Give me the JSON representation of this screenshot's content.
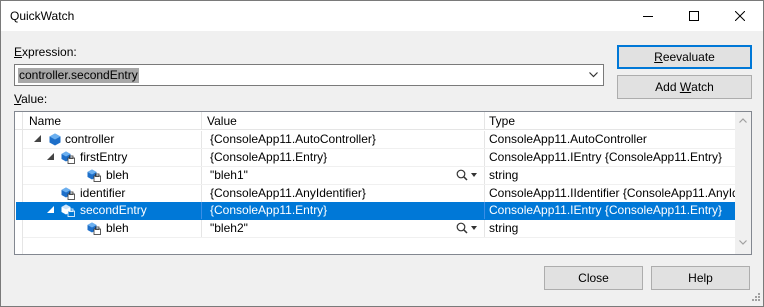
{
  "window": {
    "title": "QuickWatch"
  },
  "expression": {
    "label_prefix": "E",
    "label_rest": "xpression:",
    "value": "controller.secondEntry"
  },
  "value_section": {
    "label_prefix": "V",
    "label_rest": "alue:"
  },
  "buttons": {
    "reevaluate_prefix": "R",
    "reevaluate_rest": "eevaluate",
    "addwatch_prefix": "Add ",
    "addwatch_underline": "W",
    "addwatch_rest": "atch",
    "close": "Close",
    "help": "Help"
  },
  "grid": {
    "columns": [
      "Name",
      "Value",
      "Type"
    ],
    "rows": [
      {
        "name": "controller",
        "value": "{ConsoleApp11.AutoController}",
        "type": "ConsoleApp11.AutoController",
        "icon": "class-object-icon",
        "expanded": true,
        "selected": false
      },
      {
        "name": "firstEntry",
        "value": "{ConsoleApp11.Entry}",
        "type": "ConsoleApp11.IEntry {ConsoleApp11.Entry}",
        "icon": "private-field-icon",
        "expanded": true,
        "selected": false
      },
      {
        "name": "bleh",
        "value": "\"bleh1\"",
        "type": "string",
        "icon": "private-field-icon",
        "expanded": false,
        "selected": false,
        "has_visualizer": true
      },
      {
        "name": "identifier",
        "value": "{ConsoleApp11.AnyIdentifier}",
        "type": "ConsoleApp11.IIdentifier {ConsoleApp11.AnyIde",
        "icon": "private-field-icon",
        "expanded": false,
        "selected": false
      },
      {
        "name": "secondEntry",
        "value": "{ConsoleApp11.Entry}",
        "type": "ConsoleApp11.IEntry {ConsoleApp11.Entry}",
        "icon": "private-field-icon",
        "expanded": true,
        "selected": true
      },
      {
        "name": "bleh",
        "value": "\"bleh2\"",
        "type": "string",
        "icon": "private-field-icon",
        "expanded": false,
        "selected": false,
        "has_visualizer": true
      }
    ]
  },
  "colors": {
    "selection": "#0078d7",
    "icon_blue": "#1e6fc9",
    "default_button_border": "#0078d7"
  }
}
